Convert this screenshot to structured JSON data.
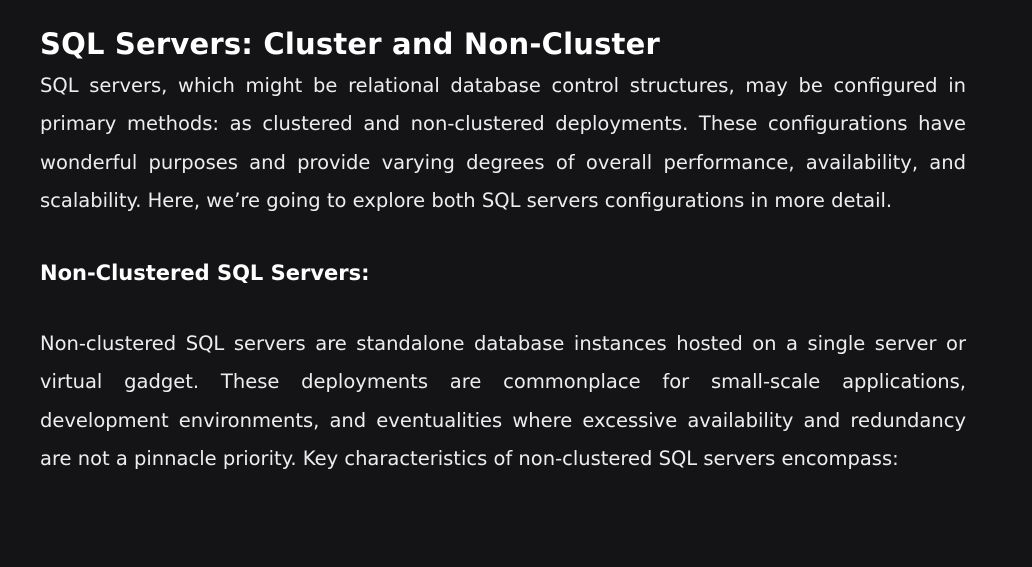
{
  "article": {
    "title": "SQL Servers: Cluster and Non-Cluster",
    "intro": "SQL servers, which might be relational database control structures, may be configured in primary methods: as clustered and non-clustered deployments. These configurations have wonderful purposes and provide varying degrees of overall performance, availability, and scalability. Here, we’re going to explore both SQL servers configurations in more detail.",
    "section_heading": "Non-Clustered SQL Servers:",
    "section_body": "Non-clustered SQL servers are standalone database instances hosted on a single server or virtual gadget. These deployments are commonplace for small-scale applications, development environments, and eventualities where excessive availability and redundancy are not a pinnacle priority. Key characteristics of non-clustered SQL servers encompass:"
  }
}
